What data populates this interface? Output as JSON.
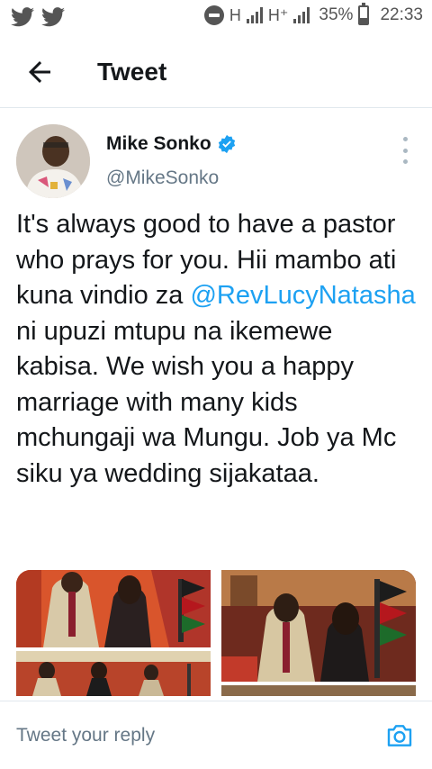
{
  "status_bar": {
    "left_icons": [
      "twitter-icon",
      "twitter-icon"
    ],
    "network_1": "H",
    "network_2": "H⁺",
    "battery": "35%",
    "time": "22:33"
  },
  "header": {
    "title": "Tweet",
    "back_icon": "arrow-left-icon"
  },
  "tweet": {
    "author_name": "Mike Sonko",
    "author_handle": "@MikeSonko",
    "verified": true,
    "text_before": "It's always good to have a pastor who prays for you. Hii mambo ati kuna vindio za ",
    "mention": "@RevLucyNatasha",
    "text_after": " ni upuzi mtupu na ikemewe kabisa. We wish you a happy marriage with many kids mchungaji wa Mungu. Job ya Mc siku ya wedding sijakataa.",
    "media_count": 4
  },
  "reply": {
    "placeholder": "Tweet your reply",
    "camera_icon": "camera-icon"
  },
  "colors": {
    "accent": "#1da1f2",
    "text": "#14171a",
    "secondary": "#657786",
    "divider": "#e1e8ed"
  }
}
